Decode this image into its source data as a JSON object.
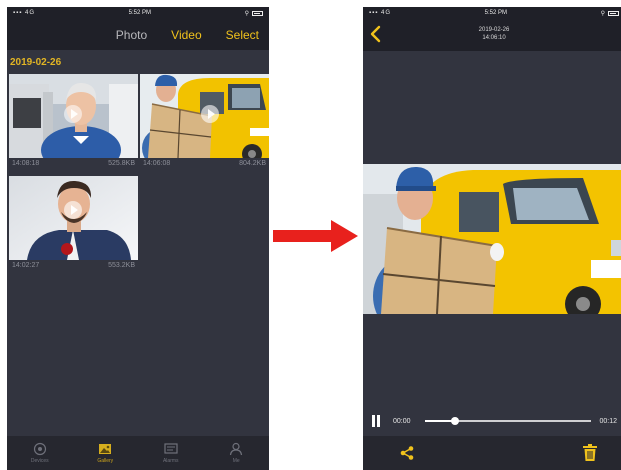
{
  "left": {
    "status": {
      "signal": "▪▪▪ 4G",
      "time": "5:52 PM"
    },
    "nav": {
      "photo": "Photo",
      "video": "Video",
      "select": "Select"
    },
    "date": "2019-02-26",
    "items": [
      {
        "time": "14:08:18",
        "size": "525.8KB"
      },
      {
        "time": "14:06:08",
        "size": "804.2KB"
      },
      {
        "time": "14:02:27",
        "size": "553.2KB"
      }
    ],
    "tabbar": [
      "Devices",
      "Gallery",
      "Alarms",
      "Me"
    ]
  },
  "right": {
    "status": {
      "signal": "▪▪▪ 4G",
      "time": "5:52 PM"
    },
    "title_date": "2019-02-26",
    "title_time": "14:06:10",
    "current_time": "00:00",
    "total_time": "00:12",
    "progress": 0.18
  },
  "colors": {
    "accent": "#f0c21c",
    "arrow": "#e8211d",
    "background": "#32343f"
  }
}
